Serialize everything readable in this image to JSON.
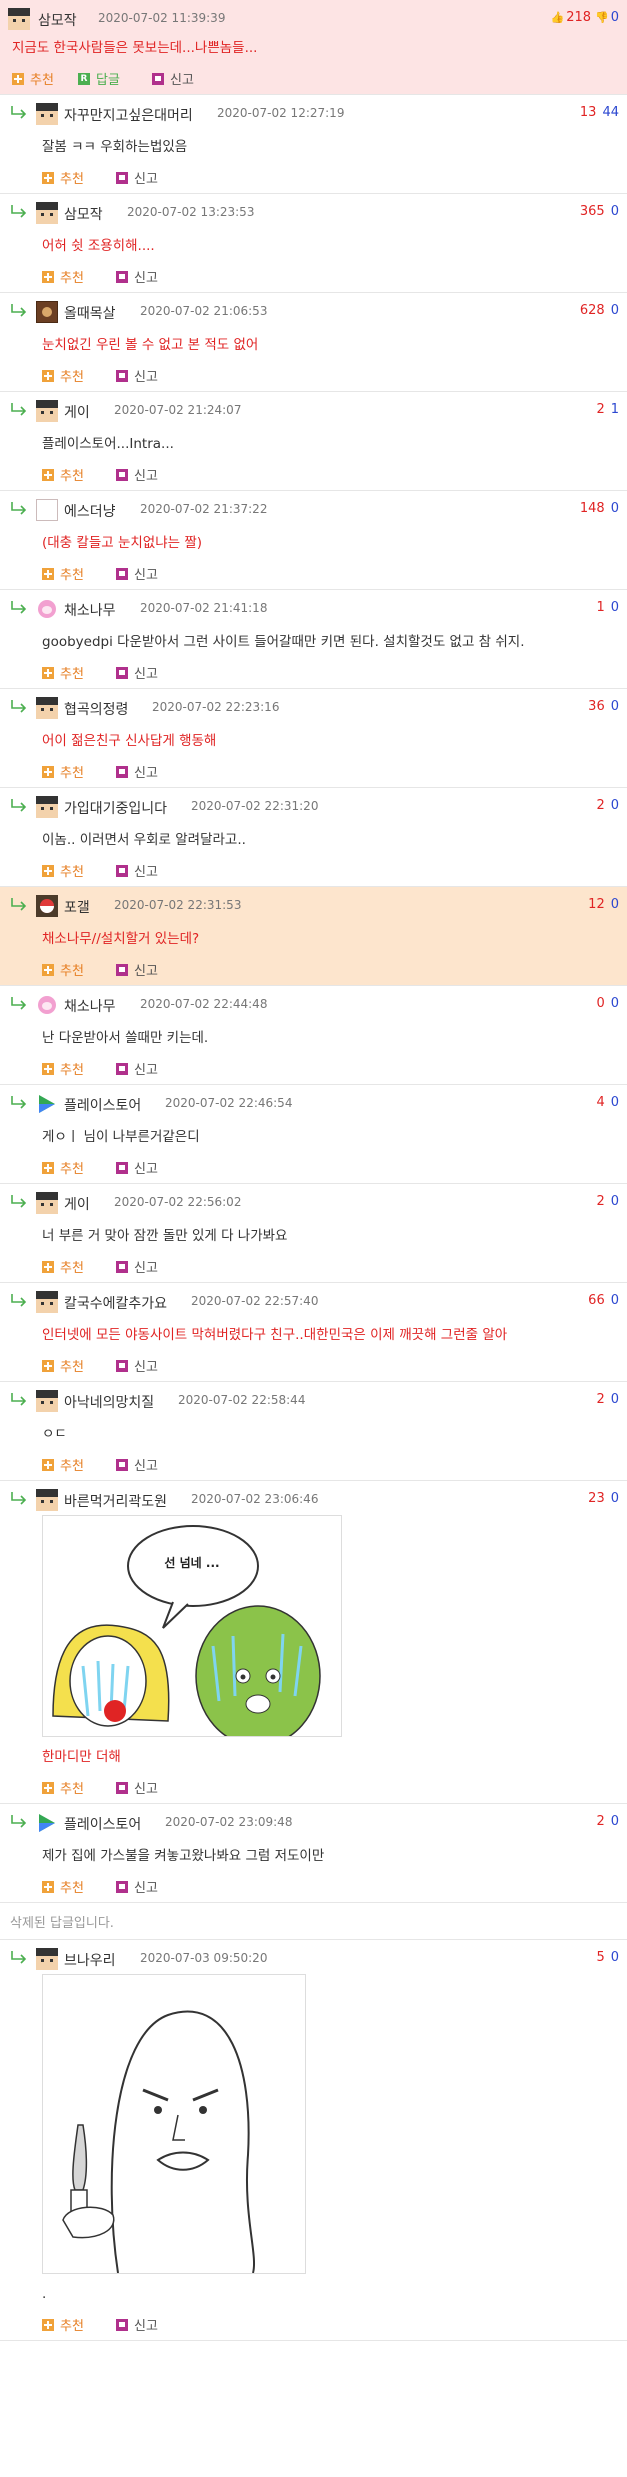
{
  "actions": {
    "recommend": "추천",
    "reply": "답글",
    "report": "신고"
  },
  "op": {
    "name": "삼모작",
    "time": "2020-07-02 11:39:39",
    "up": "218",
    "down": "0",
    "text": "지금도 한국사람들은 못보는데...나쁜놈들..."
  },
  "comments": [
    {
      "name": "자꾸만지고싶은대머리",
      "time": "2020-07-02 12:27:19",
      "up": "13",
      "down": "44",
      "text": "잘봄 ㅋㅋ 우회하는법있음",
      "avatar": "default",
      "color": "dark"
    },
    {
      "name": "삼모작",
      "time": "2020-07-02 13:23:53",
      "up": "365",
      "down": "0",
      "text": "어허 쉿 조용히해....",
      "avatar": "default",
      "color": "red"
    },
    {
      "name": "올때목살",
      "time": "2020-07-02 21:06:53",
      "up": "628",
      "down": "0",
      "text": "눈치없긴 우린 볼 수 없고 본 적도 없어",
      "avatar": "brown",
      "color": "red"
    },
    {
      "name": "게이",
      "time": "2020-07-02 21:24:07",
      "up": "2",
      "down": "1",
      "text": "플레이스토어...Intra...",
      "avatar": "default",
      "color": "dark"
    },
    {
      "name": "에스더냥",
      "time": "2020-07-02 21:37:22",
      "up": "148",
      "down": "0",
      "text": "(대충 칼들고 눈치없냐는 짤)",
      "avatar": "empty",
      "color": "red"
    },
    {
      "name": "채소나무",
      "time": "2020-07-02 21:41:18",
      "up": "1",
      "down": "0",
      "text": "goobyedpi 다운받아서 그런 사이트 들어갈때만 키면 된다. 설치할것도 없고 참 쉬지.",
      "avatar": "pink",
      "color": "dark"
    },
    {
      "name": "협곡의정령",
      "time": "2020-07-02 22:23:16",
      "up": "36",
      "down": "0",
      "text": "어이 젊은친구 신사답게 행동해",
      "avatar": "default",
      "color": "red"
    },
    {
      "name": "가입대기중입니다",
      "time": "2020-07-02 22:31:20",
      "up": "2",
      "down": "0",
      "text": "이놈.. 이러면서 우회로 알려달라고..",
      "avatar": "default",
      "color": "dark"
    },
    {
      "name": "포갤",
      "time": "2020-07-02 22:31:53",
      "up": "12",
      "down": "0",
      "text": "채소나무//설치할거 있는데?",
      "avatar": "poke",
      "color": "red",
      "highlight": true
    },
    {
      "name": "채소나무",
      "time": "2020-07-02 22:44:48",
      "up": "0",
      "down": "0",
      "text": "난 다운받아서 쓸때만 키는데.",
      "avatar": "pink",
      "color": "dark"
    },
    {
      "name": "플레이스토어",
      "time": "2020-07-02 22:46:54",
      "up": "4",
      "down": "0",
      "text": "게ㅇㅣ 님이 나부른거같은디",
      "avatar": "play",
      "color": "dark"
    },
    {
      "name": "게이",
      "time": "2020-07-02 22:56:02",
      "up": "2",
      "down": "0",
      "text": "너 부른 거 맞아 잠깐 돌만 있게 다 나가봐요",
      "avatar": "default",
      "color": "dark"
    },
    {
      "name": "칼국수에칼추가요",
      "time": "2020-07-02 22:57:40",
      "up": "66",
      "down": "0",
      "text": "인터넷에 모든 야동사이트 막혀버렸다구 친구..대한민국은 이제 깨끗해 그런줄 알아",
      "avatar": "default",
      "color": "red"
    },
    {
      "name": "아낙네의망치질",
      "time": "2020-07-02 22:58:44",
      "up": "2",
      "down": "0",
      "text": "ㅇㄷ",
      "avatar": "default",
      "color": "dark"
    },
    {
      "name": "바른먹거리곽도원",
      "time": "2020-07-02 23:06:46",
      "up": "23",
      "down": "0",
      "text": "한마디만 더해",
      "avatar": "default",
      "color": "red",
      "image": "clown",
      "bubble": "선 넘네 ..."
    },
    {
      "name": "플레이스토어",
      "time": "2020-07-02 23:09:48",
      "up": "2",
      "down": "0",
      "text": "제가 집에 가스불을 켜놓고왔나봐요 그럼 저도이만",
      "avatar": "play",
      "color": "dark"
    },
    {
      "deleted": true,
      "text": "삭제된 답글입니다."
    },
    {
      "name": "브나우리",
      "time": "2020-07-03 09:50:20",
      "up": "5",
      "down": "0",
      "text": ".",
      "avatar": "default",
      "color": "dark",
      "image": "knife"
    }
  ]
}
